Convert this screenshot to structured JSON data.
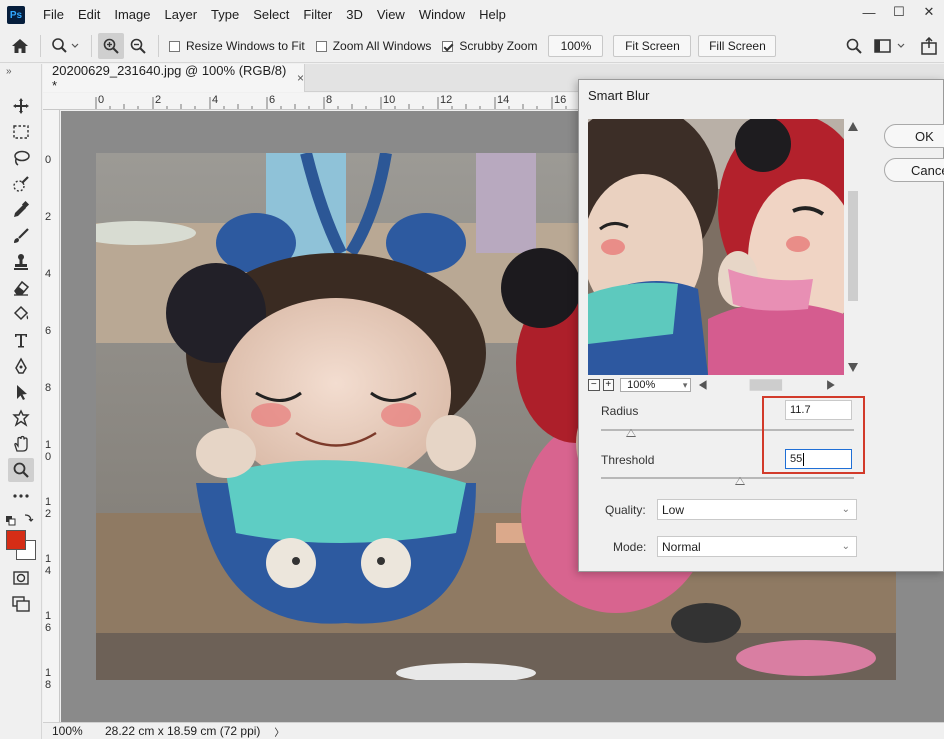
{
  "app": {
    "logo": "Ps"
  },
  "menu": [
    "File",
    "Edit",
    "Image",
    "Layer",
    "Type",
    "Select",
    "Filter",
    "3D",
    "View",
    "Window",
    "Help"
  ],
  "window_controls": {
    "minimize": "—",
    "restore": "☐",
    "close": "✕"
  },
  "options": {
    "resize_windows": {
      "label": "Resize Windows to Fit",
      "checked": false
    },
    "zoom_all": {
      "label": "Zoom All Windows",
      "checked": false
    },
    "scrubby_zoom": {
      "label": "Scrubby Zoom",
      "checked": true
    },
    "zoom_value": "100%",
    "fit_screen": "Fit Screen",
    "fill_screen": "Fill Screen"
  },
  "document": {
    "tab_title": "20200629_231640.jpg @ 100% (RGB/8) *",
    "close_glyph": "×",
    "ruler_top": [
      "0",
      "2",
      "4",
      "6",
      "8",
      "10",
      "12",
      "14",
      "16"
    ],
    "ruler_left": [
      "0",
      "2",
      "4",
      "6",
      "8",
      "1\n0",
      "1\n2",
      "1\n4",
      "1\n6",
      "1\n8"
    ]
  },
  "status": {
    "zoom": "100%",
    "doc_size": "28.22 cm x 18.59 cm (72 ppi)",
    "arrow": "〉"
  },
  "dialog": {
    "title": "Smart Blur",
    "preview_zoom": "100%",
    "radius_label": "Radius",
    "radius_value": "11.7",
    "radius_level": 0.117,
    "threshold_label": "Threshold",
    "threshold_value": "55",
    "threshold_level": 0.55,
    "quality_label": "Quality:",
    "quality_value": "Low",
    "mode_label": "Mode:",
    "mode_value": "Normal",
    "ok": "OK",
    "cancel": "Cancel"
  },
  "colors": {
    "foreground": "#d52d16",
    "background": "#ffffff",
    "highlight": "#d23a2a",
    "accent": "#1f6fd6"
  }
}
